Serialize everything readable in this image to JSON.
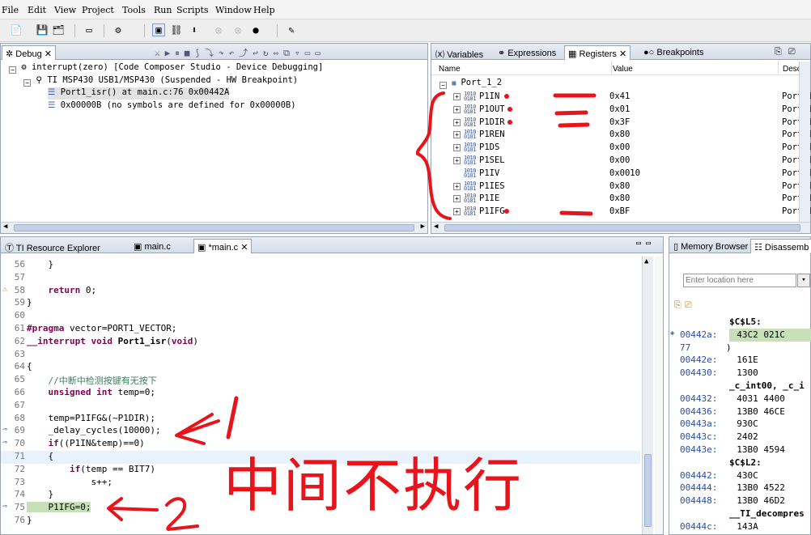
{
  "menu": [
    "File",
    "Edit",
    "View",
    "Project",
    "Tools",
    "Run",
    "Scripts",
    "Window",
    "Help"
  ],
  "debug": {
    "tab": "Debug",
    "tree": [
      "interrupt(zero) [Code Composer Studio - Device Debugging]",
      "TI MSP430 USB1/MSP430 (Suspended - HW Breakpoint)",
      "Port1_isr() at main.c:76 0x00442A",
      "0x00000B  (no symbols are defined for 0x00000B)"
    ]
  },
  "reg": {
    "tabs": [
      "Variables",
      "Expressions",
      "Registers",
      "Breakpoints"
    ],
    "headers": [
      "Name",
      "Value",
      "Descri"
    ],
    "group": "Port_1_2",
    "rows": [
      {
        "name": "P1IN",
        "value": "0x41",
        "desc": "Port 1",
        "mark": true
      },
      {
        "name": "P1OUT",
        "value": "0x01",
        "desc": "Port 1",
        "mark": true
      },
      {
        "name": "P1DIR",
        "value": "0x3F",
        "desc": "Port 1",
        "mark": true
      },
      {
        "name": "P1REN",
        "value": "0x80",
        "desc": "Port 1",
        "mark": false
      },
      {
        "name": "P1DS",
        "value": "0x00",
        "desc": "Port 1",
        "mark": false
      },
      {
        "name": "P1SEL",
        "value": "0x00",
        "desc": "Port 1",
        "mark": false
      },
      {
        "name": "P1IV",
        "value": "0x0010",
        "desc": "Port 1",
        "mark": false
      },
      {
        "name": "P1IES",
        "value": "0x80",
        "desc": "Port 1",
        "mark": false
      },
      {
        "name": "P1IE",
        "value": "0x80",
        "desc": "Port 1",
        "mark": false
      },
      {
        "name": "P1IFG",
        "value": "0xBF",
        "desc": "Port 1",
        "mark": true
      }
    ]
  },
  "editor": {
    "tabs": [
      "TI Resource Explorer",
      "main.c",
      "*main.c"
    ],
    "lines": [
      {
        "n": "56",
        "t": "    }"
      },
      {
        "n": "57",
        "t": ""
      },
      {
        "n": "58",
        "t": "    return 0;"
      },
      {
        "n": "59",
        "t": "}"
      },
      {
        "n": "60",
        "t": ""
      },
      {
        "n": "61",
        "t": "#pragma vector=PORT1_VECTOR;"
      },
      {
        "n": "62",
        "t": "__interrupt void Port1_isr(void)"
      },
      {
        "n": "63",
        "t": ""
      },
      {
        "n": "64",
        "t": "{"
      },
      {
        "n": "65",
        "t": "    //中断中检测按键有无按下"
      },
      {
        "n": "66",
        "t": "    unsigned int temp=0;"
      },
      {
        "n": "67",
        "t": ""
      },
      {
        "n": "68",
        "t": "    temp=P1IFG&(~P1DIR);"
      },
      {
        "n": "69",
        "t": "    _delay_cycles(10000);"
      },
      {
        "n": "70",
        "t": "    if((P1IN&temp)==0)"
      },
      {
        "n": "71",
        "t": "    {"
      },
      {
        "n": "72",
        "t": "        if(temp == BIT7)"
      },
      {
        "n": "73",
        "t": "            s++;"
      },
      {
        "n": "74",
        "t": "    }"
      },
      {
        "n": "75",
        "t": "    P1IFG=0;"
      },
      {
        "n": "76",
        "t": "}"
      }
    ]
  },
  "disasm": {
    "tabs": [
      "Memory Browser",
      "Disassemb"
    ],
    "location_placeholder": "Enter location here",
    "lines": [
      {
        "a": "",
        "t": "$C$L5:"
      },
      {
        "a": "00442a:",
        "t": "  43C2 021C"
      },
      {
        "a": "77",
        "t": ")"
      },
      {
        "a": "00442e:",
        "t": "  161E"
      },
      {
        "a": "004430:",
        "t": "  1300"
      },
      {
        "a": "",
        "t": "_c_int00, _c_i"
      },
      {
        "a": "004432:",
        "t": "  4031 4400"
      },
      {
        "a": "004436:",
        "t": "  13B0 46CE"
      },
      {
        "a": "00443a:",
        "t": "  930C"
      },
      {
        "a": "00443c:",
        "t": "  2402"
      },
      {
        "a": "00443e:",
        "t": "  13B0 4594"
      },
      {
        "a": "",
        "t": "$C$L2:"
      },
      {
        "a": "004442:",
        "t": "  430C"
      },
      {
        "a": "004444:",
        "t": "  13B0 4522"
      },
      {
        "a": "004448:",
        "t": "  13B0 46D2"
      },
      {
        "a": "",
        "t": "__TI_decompres"
      },
      {
        "a": "00444c:",
        "t": "  143A"
      }
    ]
  },
  "annotations": {
    "arrow1": "1",
    "arrow2": "2",
    "note": "中间不执行"
  }
}
